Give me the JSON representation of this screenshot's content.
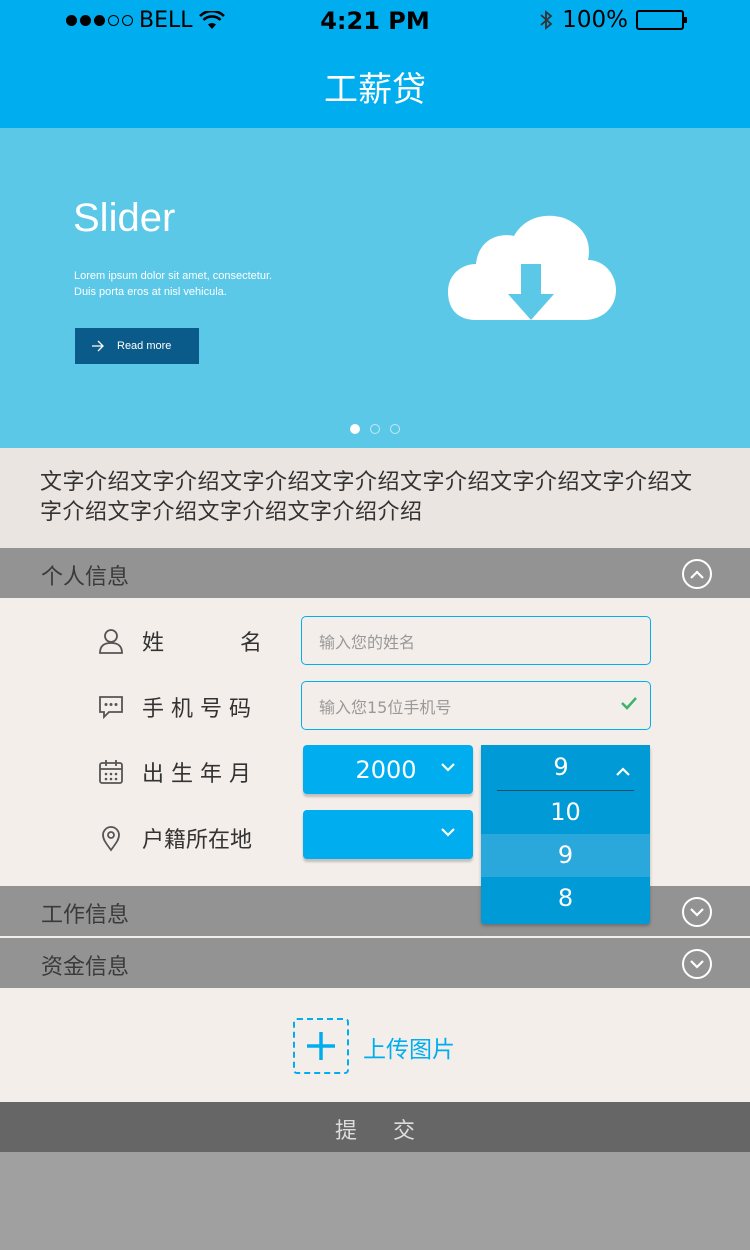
{
  "status_bar": {
    "carrier": "BELL",
    "time": "4:21 PM",
    "battery": "100%"
  },
  "nav": {
    "title": "工薪贷"
  },
  "slider": {
    "title": "Slider",
    "text_line1": "Lorem ipsum dolor sit amet, consectetur.",
    "text_line2": "Duis porta eros at nisl vehicula.",
    "button_label": "Read more",
    "active_index": 0,
    "slide_count": 3
  },
  "intro": {
    "text": "文字介绍文字介绍文字介绍文字介绍文字介绍文字介绍文字介绍文字介绍文字介绍文字介绍文字介绍介绍"
  },
  "sections": {
    "personal": {
      "title": "个人信息",
      "expanded": true
    },
    "work": {
      "title": "工作信息",
      "expanded": false
    },
    "funds": {
      "title": "资金信息",
      "expanded": false
    }
  },
  "form": {
    "name": {
      "label_a": "姓",
      "label_b": "名",
      "placeholder": "输入您的姓名"
    },
    "phone": {
      "label": "手 机 号 码",
      "placeholder": "输入您15位手机号",
      "valid": true
    },
    "birth": {
      "label": "出 生 年 月",
      "year": "2000",
      "month": "9"
    },
    "hukou": {
      "label": "户籍所在地",
      "value": ""
    }
  },
  "month_dropdown": {
    "options": [
      "10",
      "9",
      "8"
    ],
    "selected": "9"
  },
  "upload": {
    "label": "上传图片"
  },
  "submit": {
    "label": "提交"
  },
  "colors": {
    "primary": "#00aeef",
    "header_gray": "#939393",
    "submit_gray": "#666666"
  }
}
